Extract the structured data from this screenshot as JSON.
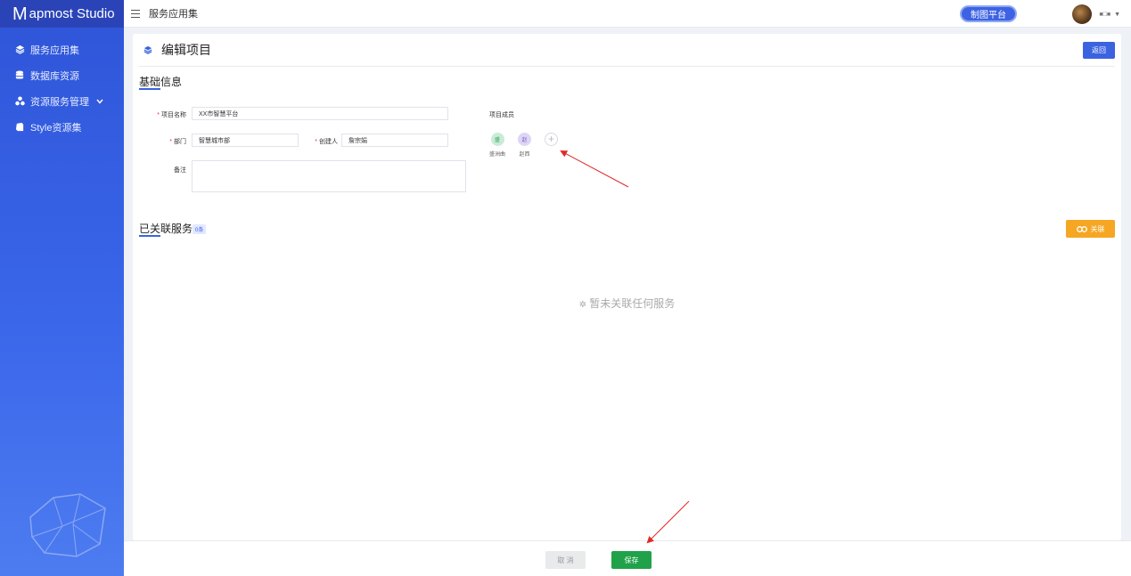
{
  "app": {
    "logo_m": "M",
    "logo_rest": "apmost Studio"
  },
  "sidebar": {
    "items": [
      {
        "label": "服务应用集",
        "icon": "layers-icon"
      },
      {
        "label": "数据库资源",
        "icon": "database-icon"
      },
      {
        "label": "资源服务管理",
        "icon": "cluster-icon",
        "expandable": true
      },
      {
        "label": "Style资源集",
        "icon": "style-icon"
      }
    ]
  },
  "topbar": {
    "breadcrumb": "服务应用集",
    "platform_button": "制图平台",
    "user_name": "■□■"
  },
  "page": {
    "title": "编辑项目",
    "back_button": "返回"
  },
  "basic_info": {
    "section_title": "基础信息",
    "project_name": {
      "label": "项目名称",
      "value": "XX市智慧平台"
    },
    "department": {
      "label": "部门",
      "value": "智慧城市部"
    },
    "creator": {
      "label": "创建人",
      "value": "詹宗娟"
    },
    "remark": {
      "label": "备注",
      "value": ""
    },
    "members": {
      "label": "项目成员",
      "list": [
        {
          "name": "盛洲曲",
          "initial": "盛",
          "color": "#c9ecd6",
          "text_color": "#2f9e5a"
        },
        {
          "name": "赵西",
          "initial": "赵",
          "color": "#ddd6f5",
          "text_color": "#7b62c9"
        }
      ]
    }
  },
  "linked_services": {
    "section_title": "已关联服务",
    "count_badge": "0条",
    "link_button": "关联",
    "empty_text": "暂未关联任何服务"
  },
  "footer": {
    "cancel_button": "取 消",
    "save_button": "保存"
  }
}
